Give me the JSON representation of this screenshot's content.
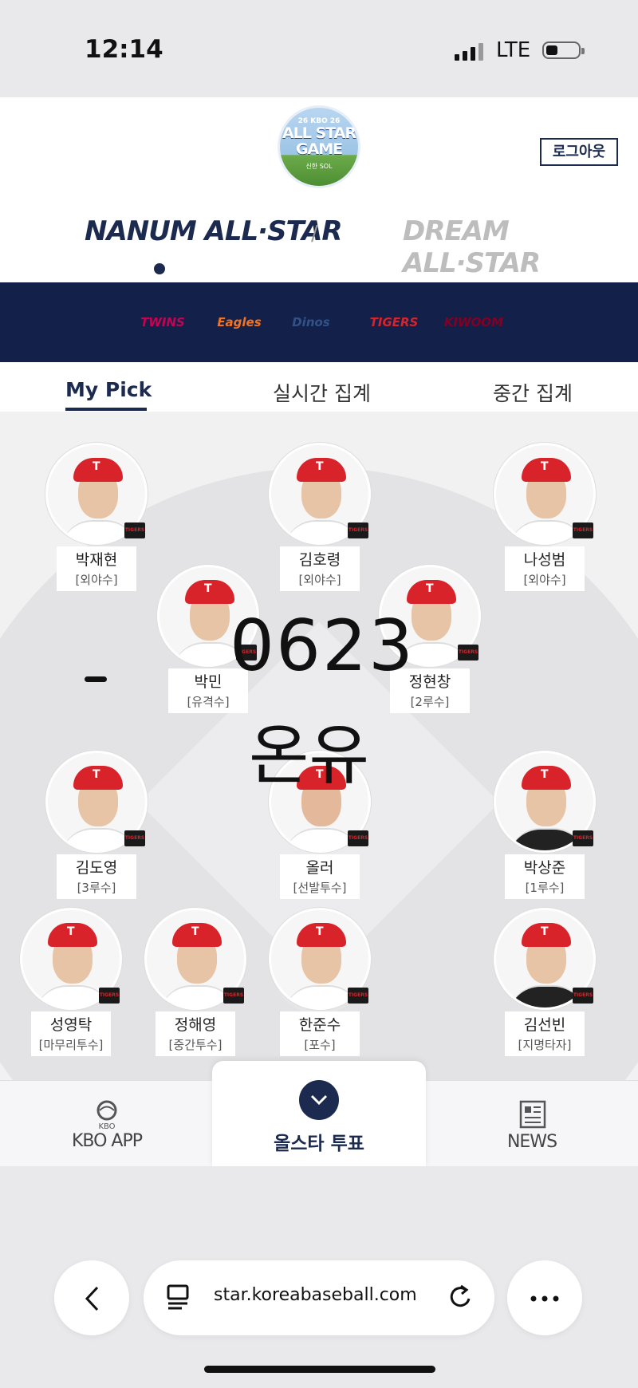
{
  "status": {
    "time": "12:14",
    "network": "LTE"
  },
  "header": {
    "logo_top": "26 KBO 26",
    "logo_main": "ALL STAR GAME",
    "logo_sub": "신한 SOL",
    "logout": "로그아웃",
    "nanum": "NANUM ALL·STAR",
    "slash": "/",
    "dream": "DREAM ALL·STAR"
  },
  "teams": [
    {
      "name": "TWINS",
      "color": "#c30452"
    },
    {
      "name": "Eagles",
      "color": "#f37321"
    },
    {
      "name": "Dinos",
      "color": "#315288"
    },
    {
      "name": "TIGERS",
      "color": "#d8232a"
    },
    {
      "name": "KIWOOM",
      "color": "#820024"
    }
  ],
  "tabs": [
    {
      "label": "My Pick",
      "active": true
    },
    {
      "label": "실시간 집계",
      "active": false
    },
    {
      "label": "중간 집계",
      "active": false
    }
  ],
  "players": [
    {
      "name": "박재현",
      "pos": "[외야수]"
    },
    {
      "name": "김호령",
      "pos": "[외야수]"
    },
    {
      "name": "나성범",
      "pos": "[외야수]"
    },
    {
      "name": "박민",
      "pos": "[유격수]"
    },
    {
      "name": "정현창",
      "pos": "[2루수]"
    },
    {
      "name": "김도영",
      "pos": "[3루수]"
    },
    {
      "name": "올러",
      "pos": "[선발투수]"
    },
    {
      "name": "박상준",
      "pos": "[1루수]"
    },
    {
      "name": "성영탁",
      "pos": "[마무리투수]"
    },
    {
      "name": "정해영",
      "pos": "[중간투수]"
    },
    {
      "name": "한준수",
      "pos": "[포수]"
    },
    {
      "name": "김선빈",
      "pos": "[지명타자]"
    }
  ],
  "badge": "TIGERS",
  "overlay": {
    "number": "0623",
    "name": "온유"
  },
  "bottomnav": {
    "left": "KBO APP",
    "left_sub": "KBO",
    "center": "올스타 투표",
    "right": "NEWS"
  },
  "browser": {
    "url": "star.koreabaseball.com"
  },
  "icons": [
    "back-icon",
    "tabs-icon",
    "reload-icon",
    "more-icon",
    "chevron-down-icon",
    "news-icon",
    "kbo-logo-icon"
  ]
}
